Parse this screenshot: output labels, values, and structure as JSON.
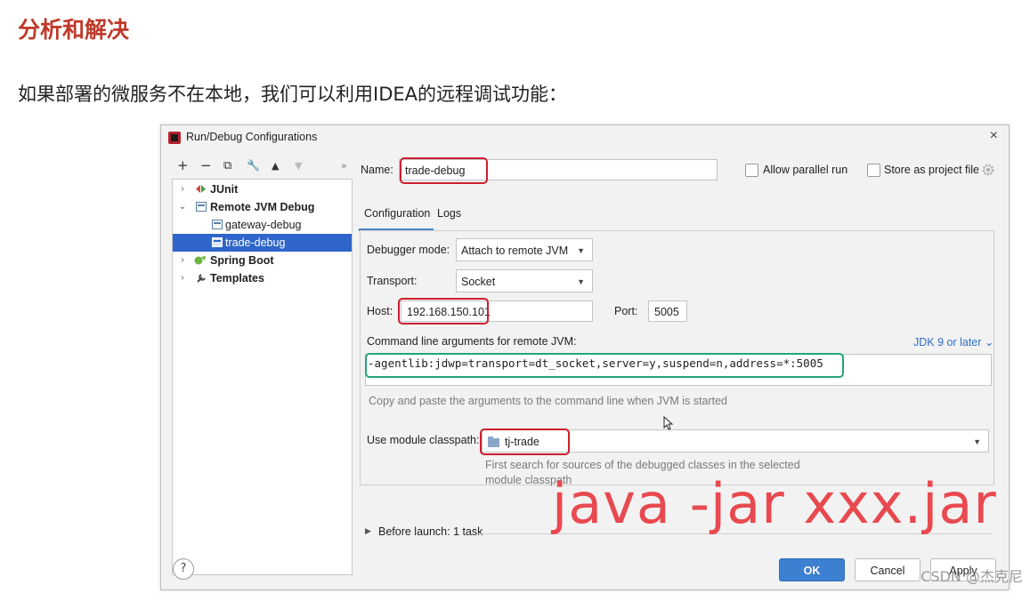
{
  "slide": {
    "title": "分析和解决",
    "text": "如果部署的微服务不在本地，我们可以利用IDEA的远程调试功能："
  },
  "dialog": {
    "title": "Run/Debug Configurations",
    "close_glyph": "×",
    "toolbar": [
      "+",
      "−",
      "⧉",
      "🔧",
      "▲",
      "▼",
      "»"
    ],
    "tree": [
      {
        "label": "JUnit",
        "bold": true,
        "expand": "›",
        "icon": "junit-icon"
      },
      {
        "label": "Remote JVM Debug",
        "bold": true,
        "expand": "⌄",
        "icon": "remote-jvm-icon"
      },
      {
        "label": "gateway-debug",
        "bold": false,
        "expand": "",
        "icon": "remote-config-icon"
      },
      {
        "label": "trade-debug",
        "bold": false,
        "expand": "",
        "icon": "remote-config-icon",
        "selected": true
      },
      {
        "label": "Spring Boot",
        "bold": true,
        "expand": "›",
        "icon": "spring-boot-icon"
      },
      {
        "label": "Templates",
        "bold": true,
        "expand": "›",
        "icon": "wrench-icon"
      }
    ],
    "name_label": "Name:",
    "name_value": "trade-debug",
    "allow_parallel_label": "Allow parallel run",
    "store_label": "Store as project file",
    "tabs": [
      "Configuration",
      "Logs"
    ],
    "debugger_mode_label": "Debugger mode:",
    "debugger_mode_value": "Attach to remote JVM",
    "transport_label": "Transport:",
    "transport_value": "Socket",
    "host_label": "Host:",
    "host_value": "192.168.150.101",
    "port_label": "Port:",
    "port_value": "5005",
    "cmd_label": "Command line arguments for remote JVM:",
    "jdk_link": "JDK 9 or later ⌄",
    "cmd_value": "-agentlib:jdwp=transport=dt_socket,server=y,suspend=n,address=*:5005",
    "cmd_hint": "Copy and paste the arguments to the command line when JVM is started",
    "module_label": "Use module classpath:",
    "module_value": "tj-trade",
    "module_hint_1": "First search for sources of the debugged classes in the selected",
    "module_hint_2": "module classpath",
    "before_launch": "Before launch: 1 task",
    "help_glyph": "?",
    "ok_label": "OK",
    "cancel_label": "Cancel",
    "apply_label": "Apply"
  },
  "overlay_text": "java -jar xxx.jar",
  "watermark": "CSDN @杰克尼",
  "colors": {
    "title_red": "#c0392b",
    "highlight_red": "#cc1f2f",
    "highlight_green": "#21a67a",
    "selection_blue": "#2f65ca",
    "ok_blue": "#3d7fd0",
    "overlay_red": "#e8494f"
  }
}
